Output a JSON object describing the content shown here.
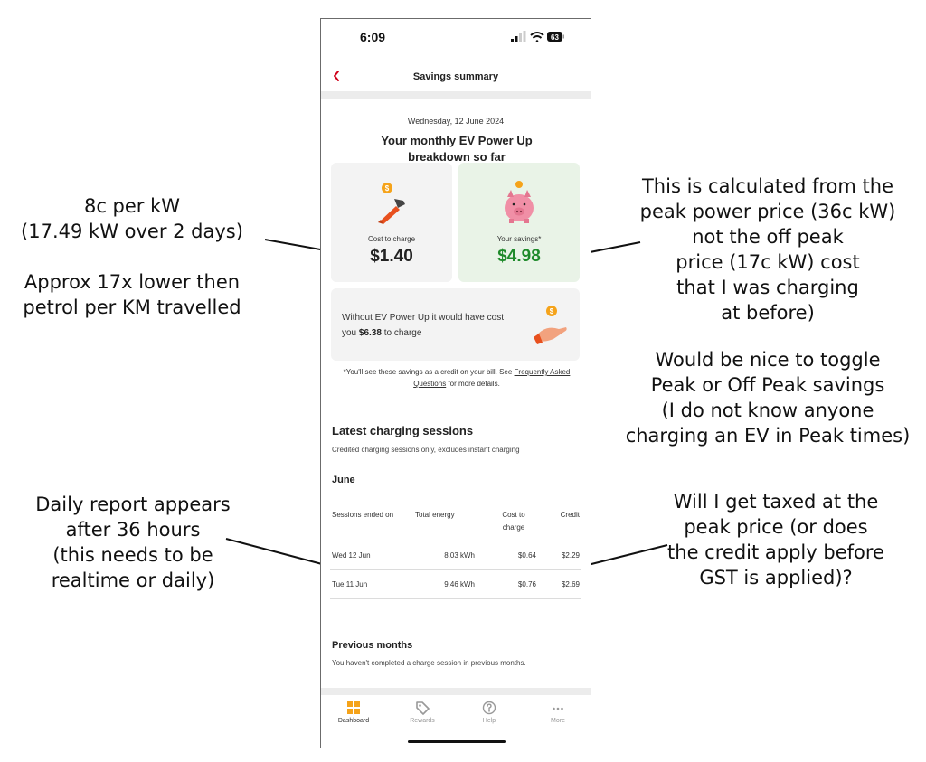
{
  "annotations": {
    "cost_note": [
      "8c per kW",
      "(17.49 kW over 2 days)",
      "",
      "Approx 17x lower then",
      "petrol per KM travelled"
    ],
    "savings_note": [
      "This is calculated from the",
      "peak power price (36c kW)",
      "not the off peak",
      "price (17c kW) cost",
      "that I was charging",
      "at before)"
    ],
    "toggle_note": [
      "Would be nice to toggle",
      "Peak or Off Peak savings",
      "(I do not know anyone",
      "charging an EV in Peak times)"
    ],
    "daily_note": [
      "Daily report appears",
      "after 36 hours",
      "(this needs to be",
      "realtime or daily)"
    ],
    "tax_note": [
      "Will I get taxed at the",
      "peak price (or does",
      "the credit apply before",
      "GST is applied)?"
    ]
  },
  "status_bar": {
    "time": "6:09",
    "battery": "63"
  },
  "header": {
    "title": "Savings summary"
  },
  "summary": {
    "date": "Wednesday, 12 June 2024",
    "headline": "Your monthly EV Power Up breakdown so far",
    "cost_label": "Cost to charge",
    "cost_value": "$1.40",
    "savings_label": "Your savings*",
    "savings_value": "$4.98",
    "without_text_1": "Without EV Power Up it would have cost you ",
    "without_amount": "$6.38",
    "without_text_2": " to charge",
    "footnote_1": "*You'll see these savings as a credit on your bill. See ",
    "footnote_link": "Frequently Asked Questions",
    "footnote_2": " for more details."
  },
  "sessions": {
    "title": "Latest charging sessions",
    "subtitle": "Credited charging sessions only, excludes instant charging",
    "month": "June",
    "columns": [
      "Sessions ended on",
      "Total energy",
      "Cost to charge",
      "Credit"
    ],
    "rows": [
      {
        "date": "Wed 12 Jun",
        "energy": "8.03 kWh",
        "cost": "$0.64",
        "credit": "$2.29"
      },
      {
        "date": "Tue 11 Jun",
        "energy": "9.46 kWh",
        "cost": "$0.76",
        "credit": "$2.69"
      }
    ]
  },
  "previous": {
    "title": "Previous months",
    "message": "You haven't completed a charge session in previous months."
  },
  "tabbar": {
    "items": [
      {
        "label": "Dashboard",
        "icon": "dashboard-icon"
      },
      {
        "label": "Rewards",
        "icon": "tag-icon"
      },
      {
        "label": "Help",
        "icon": "help-icon"
      },
      {
        "label": "More",
        "icon": "more-icon"
      }
    ]
  },
  "colors": {
    "accent": "#f5a31a",
    "savings_green": "#1f8a2b",
    "back_red": "#d0021b",
    "charger_orange": "#e8501e"
  }
}
